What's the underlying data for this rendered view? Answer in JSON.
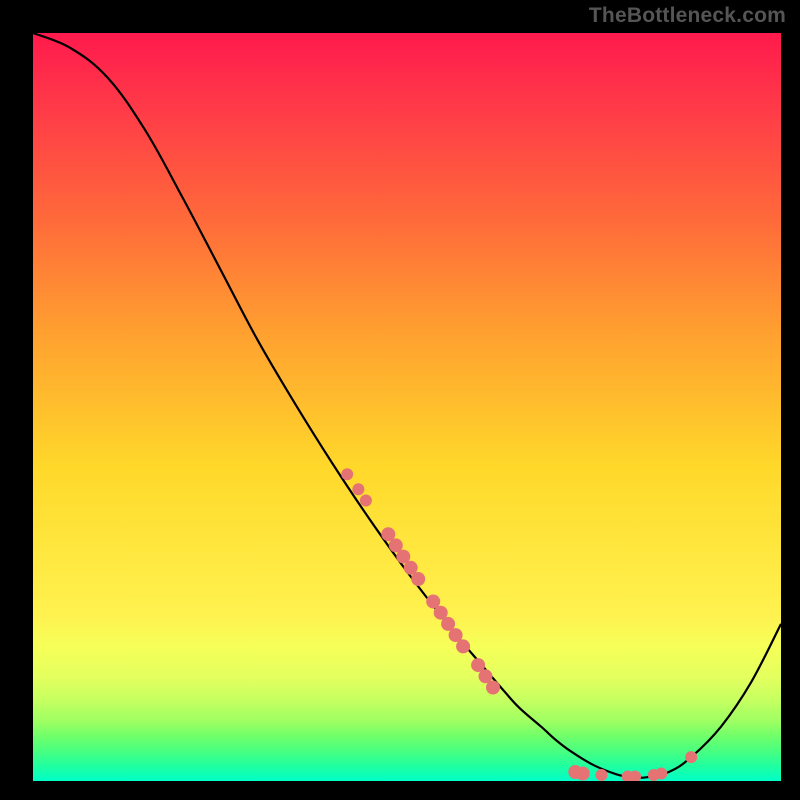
{
  "watermark": "TheBottleneck.com",
  "chart_data": {
    "type": "line",
    "title": "",
    "xlabel": "",
    "ylabel": "",
    "xlim": [
      0,
      100
    ],
    "ylim": [
      0,
      100
    ],
    "grid": false,
    "legend": false,
    "background": {
      "gradient_type": "vertical",
      "note": "vertical red-to-green gradient, green band at bottom",
      "stops": [
        {
          "pos": 0.0,
          "color": "#ff1a4d"
        },
        {
          "pos": 0.25,
          "color": "#ff6a3a"
        },
        {
          "pos": 0.58,
          "color": "#ffd82a"
        },
        {
          "pos": 0.82,
          "color": "#f6ff58"
        },
        {
          "pos": 0.94,
          "color": "#70ff6a"
        },
        {
          "pos": 1.0,
          "color": "#00ffc8"
        }
      ]
    },
    "series": [
      {
        "name": "bottleneck-curve",
        "type": "line",
        "color": "#000000",
        "x": [
          0,
          5,
          10,
          15,
          20,
          25,
          30,
          35,
          40,
          45,
          50,
          55,
          57,
          60,
          63,
          65,
          68,
          70,
          72,
          75,
          78,
          80,
          82,
          85,
          88,
          92,
          96,
          100
        ],
        "y": [
          100,
          98,
          94,
          87,
          78,
          68.5,
          59,
          50.5,
          42.5,
          35,
          28,
          21.5,
          19,
          15.5,
          12,
          9.8,
          7.2,
          5.4,
          3.9,
          2.1,
          0.9,
          0.5,
          0.5,
          1.2,
          3.2,
          7.3,
          13.2,
          21
        ],
        "note": "y values are percentages (0=bottom green, 100=top red); curve is steep descent then slight rise"
      }
    ],
    "points": [
      {
        "name": "cluster-high-1",
        "x": 42,
        "y": 41,
        "r": 6
      },
      {
        "name": "cluster-high-2",
        "x": 43.5,
        "y": 39,
        "r": 6
      },
      {
        "name": "cluster-high-3",
        "x": 44.5,
        "y": 37.5,
        "r": 6
      },
      {
        "name": "cluster-mid-1",
        "x": 47.5,
        "y": 33,
        "r": 7
      },
      {
        "name": "cluster-mid-2",
        "x": 48.5,
        "y": 31.5,
        "r": 7
      },
      {
        "name": "cluster-mid-3",
        "x": 49.5,
        "y": 30,
        "r": 7
      },
      {
        "name": "cluster-mid-4",
        "x": 50.5,
        "y": 28.5,
        "r": 7
      },
      {
        "name": "cluster-mid-5",
        "x": 51.5,
        "y": 27,
        "r": 7
      },
      {
        "name": "cluster-low-1",
        "x": 53.5,
        "y": 24,
        "r": 7
      },
      {
        "name": "cluster-low-2",
        "x": 54.5,
        "y": 22.5,
        "r": 7
      },
      {
        "name": "cluster-low-3",
        "x": 55.5,
        "y": 21,
        "r": 7
      },
      {
        "name": "cluster-low-4",
        "x": 56.5,
        "y": 19.5,
        "r": 7
      },
      {
        "name": "cluster-low-5",
        "x": 57.5,
        "y": 18,
        "r": 7
      },
      {
        "name": "cluster-vlow-1",
        "x": 59.5,
        "y": 15.5,
        "r": 7
      },
      {
        "name": "cluster-vlow-2",
        "x": 60.5,
        "y": 14,
        "r": 7
      },
      {
        "name": "cluster-vlow-3",
        "x": 61.5,
        "y": 12.5,
        "r": 7
      },
      {
        "name": "bottom-1",
        "x": 72.5,
        "y": 1.2,
        "r": 7
      },
      {
        "name": "bottom-2",
        "x": 73.5,
        "y": 1.0,
        "r": 7
      },
      {
        "name": "bottom-3",
        "x": 76,
        "y": 0.8,
        "r": 6
      },
      {
        "name": "bottom-4",
        "x": 79.5,
        "y": 0.6,
        "r": 6
      },
      {
        "name": "bottom-5",
        "x": 80.5,
        "y": 0.6,
        "r": 6
      },
      {
        "name": "bottom-6",
        "x": 83,
        "y": 0.8,
        "r": 6
      },
      {
        "name": "bottom-7",
        "x": 84,
        "y": 1.0,
        "r": 6
      },
      {
        "name": "rise-1",
        "x": 88,
        "y": 3.2,
        "r": 6
      }
    ],
    "point_color": "#e57373"
  }
}
